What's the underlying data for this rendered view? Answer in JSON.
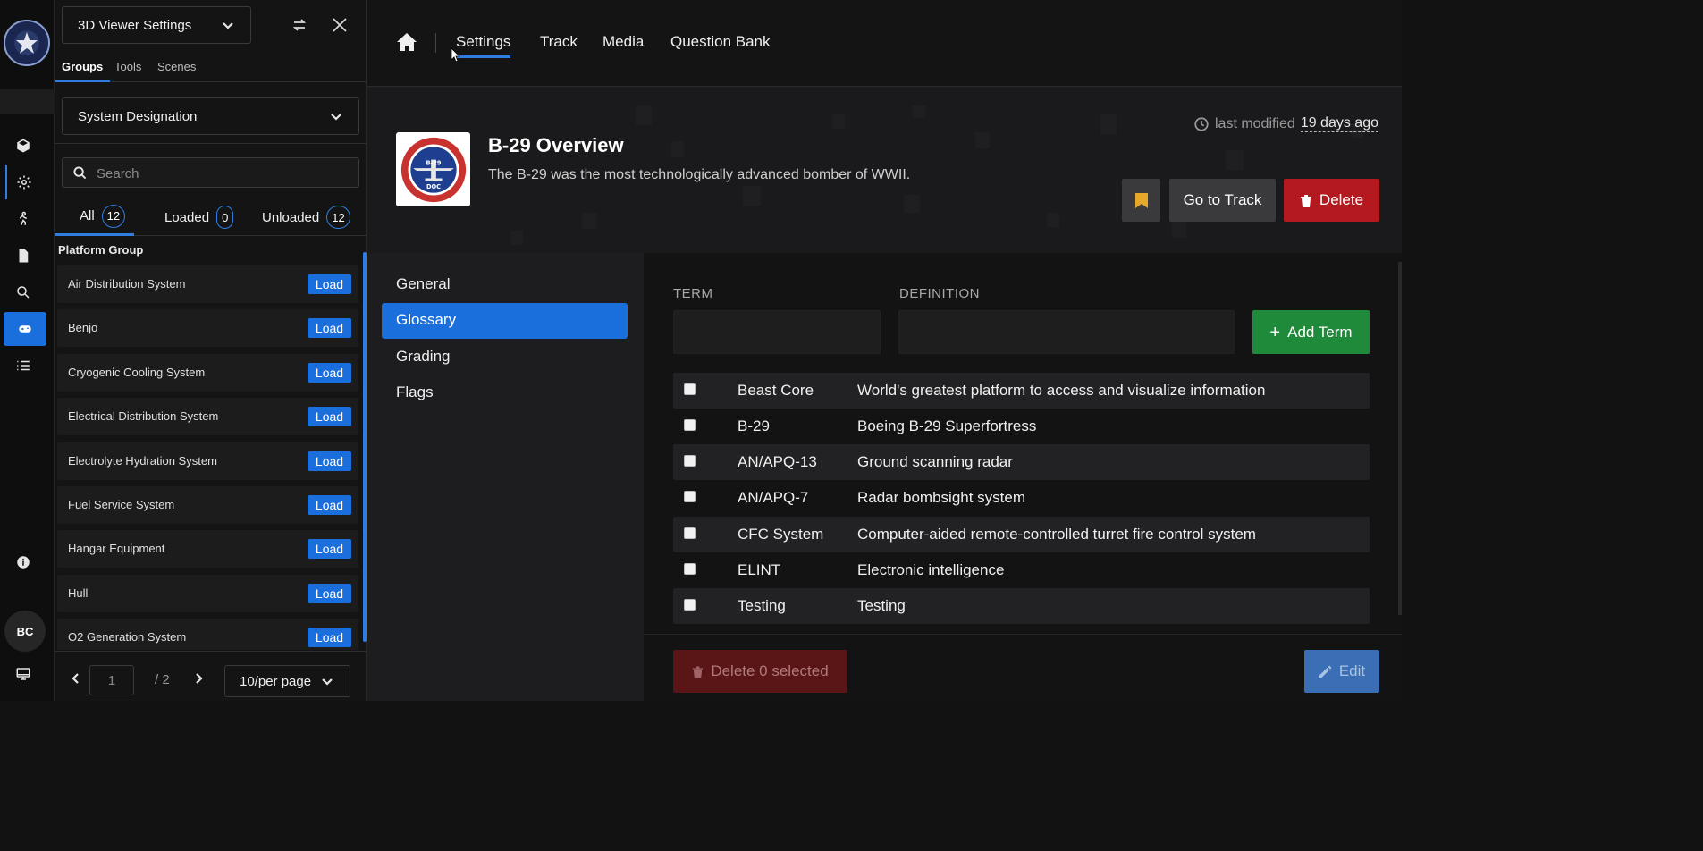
{
  "app": {
    "avatar_initials": "BC"
  },
  "panel": {
    "viewer_select": "3D Viewer Settings",
    "tabs": [
      "Groups",
      "Tools",
      "Scenes"
    ],
    "group_select": "System Designation",
    "search_placeholder": "Search",
    "filters": [
      {
        "label": "All",
        "count": "12"
      },
      {
        "label": "Loaded",
        "count": "0"
      },
      {
        "label": "Unloaded",
        "count": "12"
      }
    ],
    "list_header": "Platform Group",
    "load_label": "Load",
    "items": [
      "Air Distribution System",
      "Benjo",
      "Cryogenic Cooling System",
      "Electrical Distribution System",
      "Electrolyte Hydration System",
      "Fuel Service System",
      "Hangar Equipment",
      "Hull",
      "O2 Generation System"
    ],
    "pager": {
      "page": "1",
      "total": "/ 2",
      "page_size": "10/per page"
    }
  },
  "topnav": {
    "links": [
      "Settings",
      "Track",
      "Media",
      "Question Bank"
    ]
  },
  "hero": {
    "title": "B-29 Overview",
    "description": "The B-29 was the most technologically advanced bomber of WWII.",
    "modified_label": "last modified",
    "modified_ago": "19 days ago",
    "go_to_track": "Go to Track",
    "delete": "Delete",
    "badge_text": {
      "ring": "SUPERFORTRESS",
      "center": "B-29",
      "sub": "DOC",
      "bottom": "HONOR EDUCATE INSPIRE"
    }
  },
  "sections": [
    "General",
    "Glossary",
    "Grading",
    "Flags"
  ],
  "glossary": {
    "term_header": "TERM",
    "definition_header": "DEFINITION",
    "add_term": "Add Term",
    "rows": [
      {
        "term": "Beast Core",
        "definition": "World's greatest platform to access and visualize information"
      },
      {
        "term": "B-29",
        "definition": "Boeing B-29 Superfortress"
      },
      {
        "term": "AN/APQ-13",
        "definition": "Ground scanning radar"
      },
      {
        "term": "AN/APQ-7",
        "definition": "Radar bombsight system"
      },
      {
        "term": "CFC System",
        "definition": "Computer-aided remote-controlled turret fire control system"
      },
      {
        "term": "ELINT",
        "definition": "Electronic intelligence"
      },
      {
        "term": "Testing",
        "definition": "Testing"
      }
    ],
    "delete_selected": "Delete 0 selected",
    "edit": "Edit"
  },
  "colors": {
    "accent": "#1a6fdc",
    "danger": "#b3191e",
    "success": "#1e8a3a",
    "bookmark": "#e5a82a"
  }
}
